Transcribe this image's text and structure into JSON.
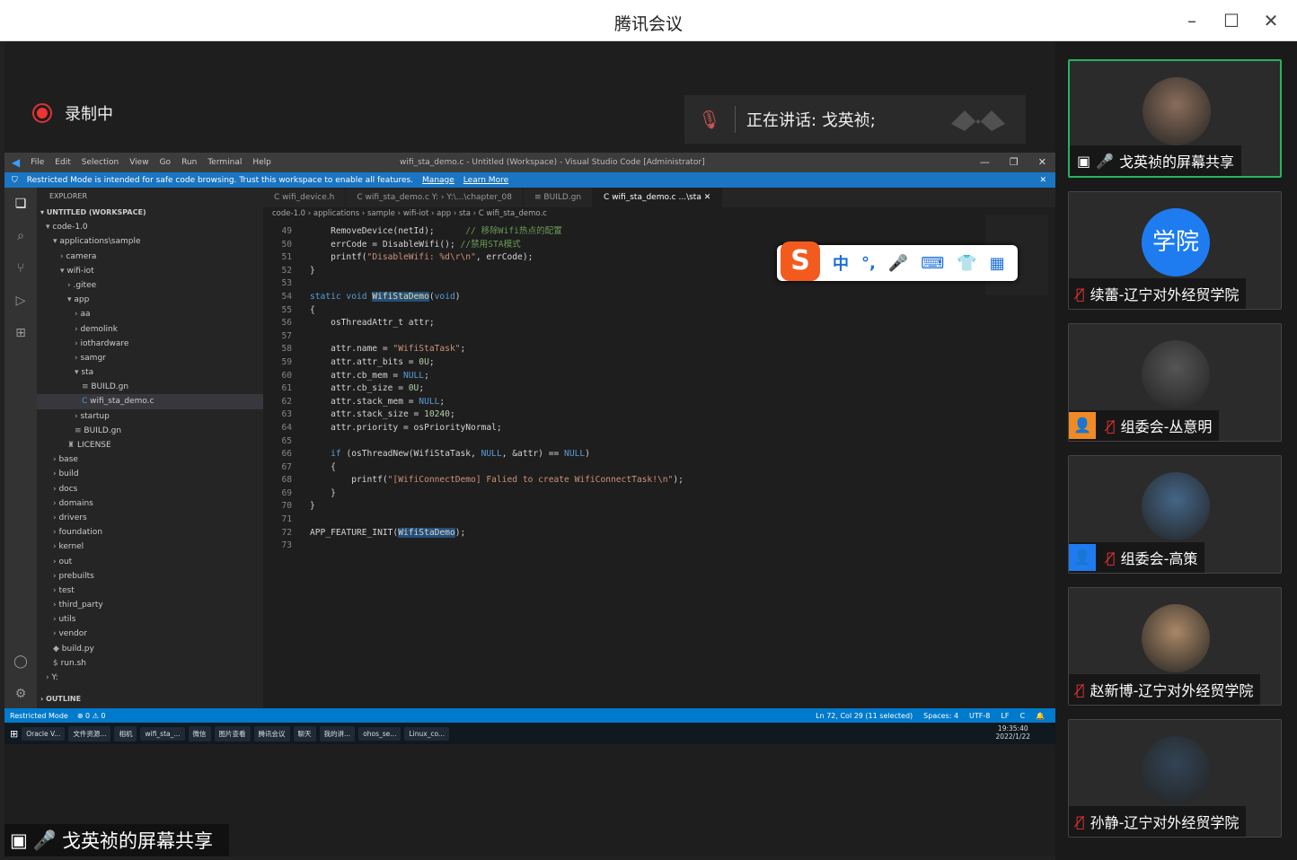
{
  "window": {
    "title": "腾讯会议"
  },
  "recording": {
    "label": "录制中"
  },
  "speaking": {
    "label": "正在讲话: 戈英祯;"
  },
  "vscode": {
    "menu": [
      "File",
      "Edit",
      "Selection",
      "View",
      "Go",
      "Run",
      "Terminal",
      "Help"
    ],
    "title": "wifi_sta_demo.c - Untitled (Workspace) - Visual Studio Code [Administrator]",
    "banner": {
      "text": "Restricted Mode is intended for safe code browsing. Trust this workspace to enable all features.",
      "manage": "Manage",
      "learn": "Learn More"
    },
    "explorer_title": "EXPLORER",
    "workspace": "UNTITLED (WORKSPACE)",
    "tree": [
      {
        "label": "code-1.0",
        "indent": 1,
        "icon": "▾"
      },
      {
        "label": "applications\\sample",
        "indent": 2,
        "icon": "▾"
      },
      {
        "label": "camera",
        "indent": 3,
        "icon": "›"
      },
      {
        "label": "wifi-iot",
        "indent": 3,
        "icon": "▾"
      },
      {
        "label": ".gitee",
        "indent": 4,
        "icon": "›"
      },
      {
        "label": "app",
        "indent": 4,
        "icon": "▾"
      },
      {
        "label": "aa",
        "indent": 5,
        "icon": "›"
      },
      {
        "label": "demolink",
        "indent": 5,
        "icon": "›"
      },
      {
        "label": "iothardware",
        "indent": 5,
        "icon": "›"
      },
      {
        "label": "samgr",
        "indent": 5,
        "icon": "›"
      },
      {
        "label": "sta",
        "indent": 5,
        "icon": "▾"
      },
      {
        "label": "BUILD.gn",
        "indent": 6,
        "icon": "≡"
      },
      {
        "label": "wifi_sta_demo.c",
        "indent": 6,
        "icon": "C",
        "selected": true
      },
      {
        "label": "startup",
        "indent": 5,
        "icon": "›"
      },
      {
        "label": "BUILD.gn",
        "indent": 5,
        "icon": "≡"
      },
      {
        "label": "LICENSE",
        "indent": 4,
        "icon": "♜"
      },
      {
        "label": "base",
        "indent": 2,
        "icon": "›"
      },
      {
        "label": "build",
        "indent": 2,
        "icon": "›"
      },
      {
        "label": "docs",
        "indent": 2,
        "icon": "›"
      },
      {
        "label": "domains",
        "indent": 2,
        "icon": "›"
      },
      {
        "label": "drivers",
        "indent": 2,
        "icon": "›"
      },
      {
        "label": "foundation",
        "indent": 2,
        "icon": "›"
      },
      {
        "label": "kernel",
        "indent": 2,
        "icon": "›"
      },
      {
        "label": "out",
        "indent": 2,
        "icon": "›"
      },
      {
        "label": "prebuilts",
        "indent": 2,
        "icon": "›"
      },
      {
        "label": "test",
        "indent": 2,
        "icon": "›"
      },
      {
        "label": "third_party",
        "indent": 2,
        "icon": "›"
      },
      {
        "label": "utils",
        "indent": 2,
        "icon": "›"
      },
      {
        "label": "vendor",
        "indent": 2,
        "icon": "›"
      },
      {
        "label": "build.py",
        "indent": 2,
        "icon": "◆"
      },
      {
        "label": "run.sh",
        "indent": 2,
        "icon": "$"
      },
      {
        "label": "Y:",
        "indent": 1,
        "icon": "›"
      }
    ],
    "outline": "OUTLINE",
    "tabs": [
      {
        "label": "C  wifi_device.h"
      },
      {
        "label": "C  wifi_sta_demo.c  Y: › Y:\\...\\chapter_08"
      },
      {
        "label": "≡  BUILD.gn"
      },
      {
        "label": "C  wifi_sta_demo.c  ...\\sta  ✕",
        "active": true
      }
    ],
    "breadcrumb": "code-1.0 › applications › sample › wifi-iot › app › sta › C  wifi_sta_demo.c",
    "code": [
      {
        "no": "49",
        "html": "    RemoveDevice(netId);      <span class='cm'>// 移除Wifi热点的配置</span>"
      },
      {
        "no": "50",
        "html": "    errCode = DisableWifi(); <span class='cm'>//禁用STA模式</span>"
      },
      {
        "no": "51",
        "html": "    printf(<span class='str'>\"DisableWifi: %d\\r\\n\"</span>, errCode);"
      },
      {
        "no": "52",
        "html": "}"
      },
      {
        "no": "53",
        "html": ""
      },
      {
        "no": "54",
        "html": "<span class='kw'>static void</span> <span class='fn hl'>WifiStaDemo</span>(<span class='kw'>void</span>)"
      },
      {
        "no": "55",
        "html": "{"
      },
      {
        "no": "56",
        "html": "    osThreadAttr_t attr;"
      },
      {
        "no": "57",
        "html": ""
      },
      {
        "no": "58",
        "html": "    attr.name = <span class='str'>\"WifiStaTask\"</span>;"
      },
      {
        "no": "59",
        "html": "    attr.attr_bits = <span class='num'>0U</span>;"
      },
      {
        "no": "60",
        "html": "    attr.cb_mem = <span class='kw'>NULL</span>;"
      },
      {
        "no": "61",
        "html": "    attr.cb_size = <span class='num'>0U</span>;"
      },
      {
        "no": "62",
        "html": "    attr.stack_mem = <span class='kw'>NULL</span>;"
      },
      {
        "no": "63",
        "html": "    attr.stack_size = <span class='num'>10240</span>;"
      },
      {
        "no": "64",
        "html": "    attr.priority = osPriorityNormal;"
      },
      {
        "no": "65",
        "html": ""
      },
      {
        "no": "66",
        "html": "    <span class='kw'>if</span> (osThreadNew(WifiStaTask, <span class='kw'>NULL</span>, &amp;attr) == <span class='kw'>NULL</span>)"
      },
      {
        "no": "67",
        "html": "    {"
      },
      {
        "no": "68",
        "html": "        printf(<span class='str'>\"[WifiConnectDemo] Falied to create WifiConnectTask!\\n\"</span>);"
      },
      {
        "no": "69",
        "html": "    }"
      },
      {
        "no": "70",
        "html": "}"
      },
      {
        "no": "71",
        "html": ""
      },
      {
        "no": "72",
        "html": "APP_FEATURE_INIT(<span class='hl'>WifiStaDemo</span>);"
      },
      {
        "no": "73",
        "html": ""
      }
    ],
    "ime": [
      "中",
      "°,",
      "🎤",
      "⌨",
      "👕",
      "▦"
    ],
    "status": {
      "mode": "Restricted Mode",
      "problems": "⊗ 0  ⚠ 0",
      "pos": "Ln 72, Col 29 (11 selected)",
      "spaces": "Spaces: 4",
      "enc": "UTF-8",
      "eol": "LF",
      "lang": "C"
    },
    "taskbar": [
      "Oracle V...",
      "文件资源...",
      "相机",
      "wifi_sta_...",
      "微信",
      "图片查看",
      "腾讯会议",
      "聊天",
      "我的讲...",
      "ohos_se...",
      "Linux_co..."
    ],
    "clock": {
      "time": "19:35:40",
      "date": "2022/1/22"
    }
  },
  "share_label": "戈英祯的屏幕共享",
  "participants": [
    {
      "name": "戈英祯的屏幕共享",
      "active": true,
      "muted": false
    },
    {
      "name": "续蕾-辽宁对外经贸学院",
      "avatar_text": "学院",
      "muted": true
    },
    {
      "name": "组委会-丛意明",
      "muted": true,
      "badge": "orange"
    },
    {
      "name": "组委会-高策",
      "muted": true,
      "badge": "blue"
    },
    {
      "name": "赵新博-辽宁对外经贸学院",
      "muted": true
    },
    {
      "name": "孙静-辽宁对外经贸学院",
      "muted": true
    }
  ],
  "colors": {
    "active_border": "#26b361",
    "vscode_blue": "#007acc",
    "mute": "#e33333"
  }
}
